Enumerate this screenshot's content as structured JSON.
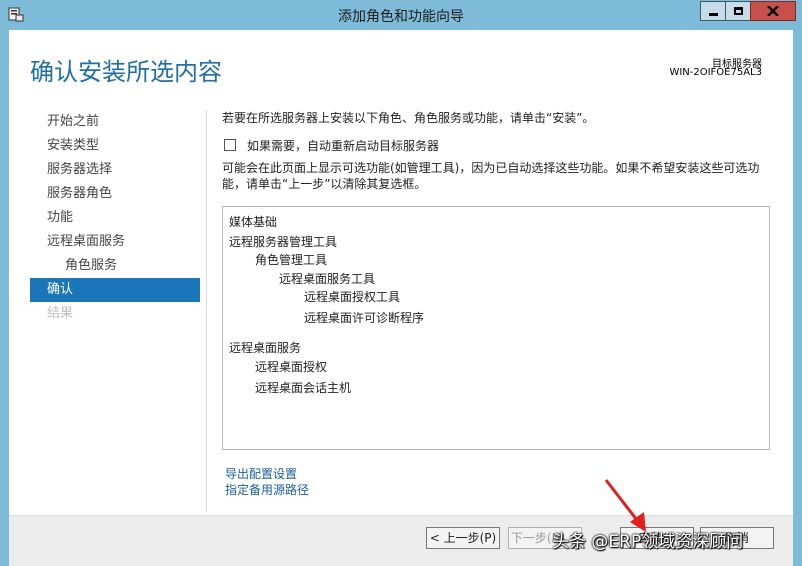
{
  "window": {
    "title": "添加角色和功能向导"
  },
  "header": {
    "page_title": "确认安装所选内容",
    "target_label": "目标服务器",
    "target_name": "WIN-2OIFOE75AL3"
  },
  "nav": {
    "items": [
      {
        "label": "开始之前"
      },
      {
        "label": "安装类型"
      },
      {
        "label": "服务器选择"
      },
      {
        "label": "服务器角色"
      },
      {
        "label": "功能"
      },
      {
        "label": "远程桌面服务"
      },
      {
        "label": "角色服务"
      },
      {
        "label": "确认"
      },
      {
        "label": "结果"
      }
    ]
  },
  "content": {
    "intro": "若要在所选服务器上安装以下角色、角色服务或功能，请单击“安装”。",
    "restart_label": "如果需要，自动重新启动目标服务器",
    "note": "可能会在此页面上显示可选功能(如管理工具)，因为已自动选择这些功能。如果不希望安装这些可选功能，请单击“上一步”以清除其复选框。",
    "features": [
      "媒体基础",
      "远程服务器管理工具",
      "角色管理工具",
      "远程桌面服务工具",
      "远程桌面授权工具",
      "远程桌面许可诊断程序",
      "远程桌面服务",
      "远程桌面授权",
      "远程桌面会话主机"
    ],
    "link_export": "导出配置设置",
    "link_alt_source": "指定备用源路径"
  },
  "buttons": {
    "prev": "< 上一步(P)",
    "next": "下一步(N) >",
    "install": "安装(I)",
    "cancel": "取消"
  },
  "watermark": "头条 @ERP领域资深顾问",
  "colors": {
    "titlebar": "#7dbbd8",
    "accent": "#1a76b8",
    "title_text": "#1f6fa6",
    "close_button": "#c7504a",
    "annotation_arrow": "#e02020"
  }
}
